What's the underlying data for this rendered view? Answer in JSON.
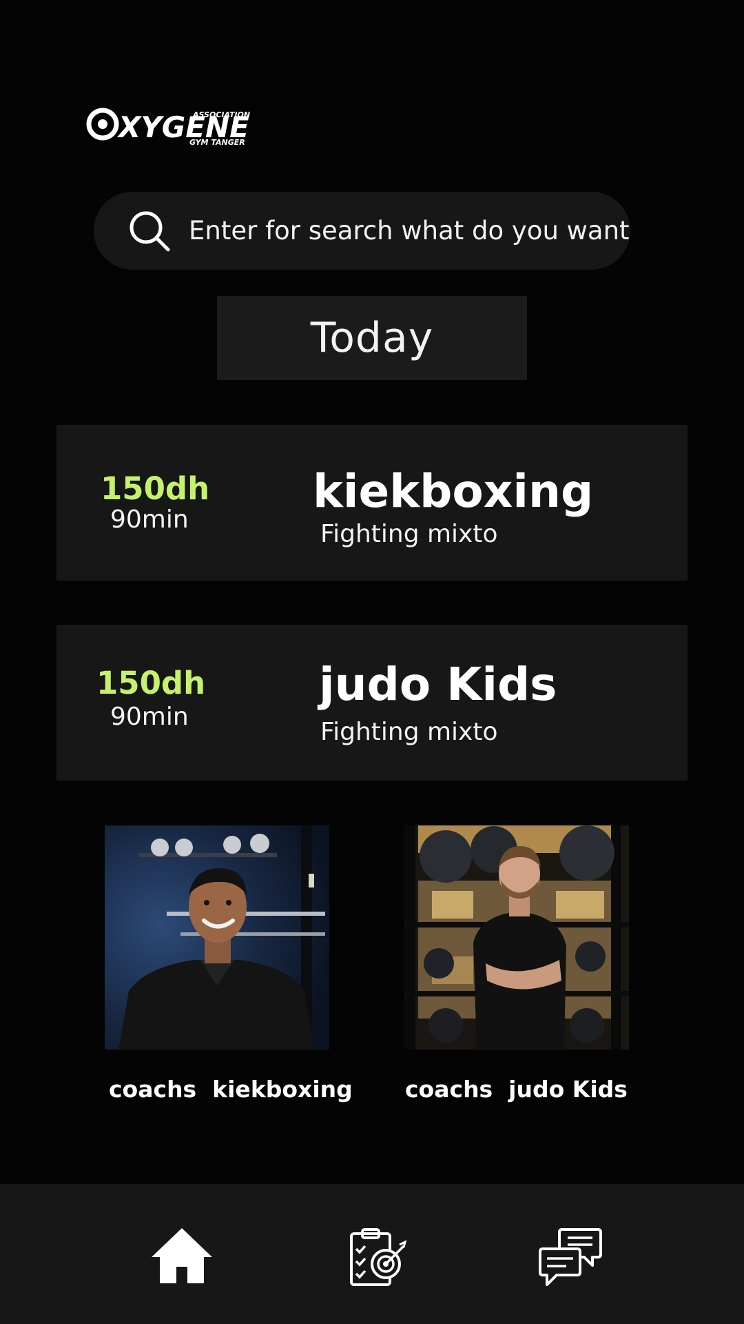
{
  "logo": {
    "brand": "XYGENE",
    "tagline_top": "ASSOCIATION",
    "tagline_bottom": "GYM TANGER"
  },
  "search": {
    "placeholder": "Enter for search what do you want"
  },
  "today_tab": {
    "label": "Today"
  },
  "classes": [
    {
      "price": "150dh",
      "duration": "90min",
      "name": "kiekboxing",
      "type": "Fighting mixto"
    },
    {
      "price": "150dh",
      "duration": "90min",
      "name": "judo Kids",
      "type": "Fighting mixto"
    }
  ],
  "coaches": [
    {
      "label": "coachs  kiekboxing"
    },
    {
      "label": "coachs  judo Kids"
    }
  ],
  "nav": {
    "items": [
      "home-icon",
      "goals-clipboard-icon",
      "chat-icon"
    ]
  },
  "colors": {
    "background": "#040404",
    "card": "#171717",
    "accent": "#c6f26b"
  }
}
